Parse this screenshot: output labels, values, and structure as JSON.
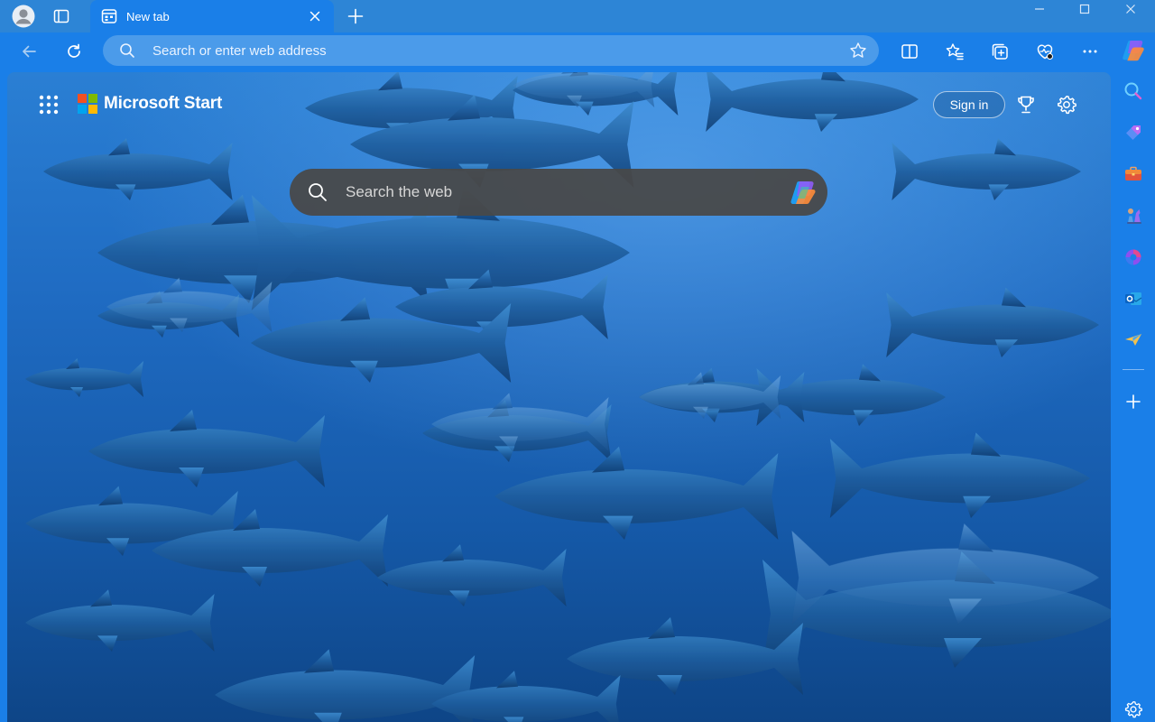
{
  "window": {
    "controls": [
      "minimize",
      "maximize",
      "close"
    ]
  },
  "tabs": [
    {
      "title": "New tab",
      "icon": "new-tab-page-icon",
      "active": true
    }
  ],
  "toolbar": {
    "address_placeholder": "Search or enter web address",
    "buttons": [
      "back-icon",
      "refresh-icon",
      "split-screen-icon",
      "favorites-icon",
      "collections-icon",
      "browser-essentials-icon",
      "more-icon",
      "copilot-icon"
    ]
  },
  "page": {
    "brand": "Microsoft Start",
    "sign_in": "Sign in",
    "search_placeholder": "Search the web",
    "header_icons": [
      "apps-grid-icon",
      "rewards-trophy-icon",
      "settings-gear-icon"
    ]
  },
  "sidebar": {
    "items": [
      "search-icon",
      "shopping-tag-icon",
      "tools-briefcase-icon",
      "games-chess-icon",
      "microsoft365-icon",
      "outlook-icon",
      "drop-icon",
      "add-icon",
      "sidebar-settings-icon"
    ]
  },
  "colors": {
    "chrome": "#1a7fe8",
    "titlebar": "#2d85d6",
    "addressbar": "#4b9bea",
    "search_box": "#484848",
    "ms_red": "#f25022",
    "ms_green": "#7fba00",
    "ms_blue": "#00a4ef",
    "ms_yellow": "#ffb900"
  }
}
